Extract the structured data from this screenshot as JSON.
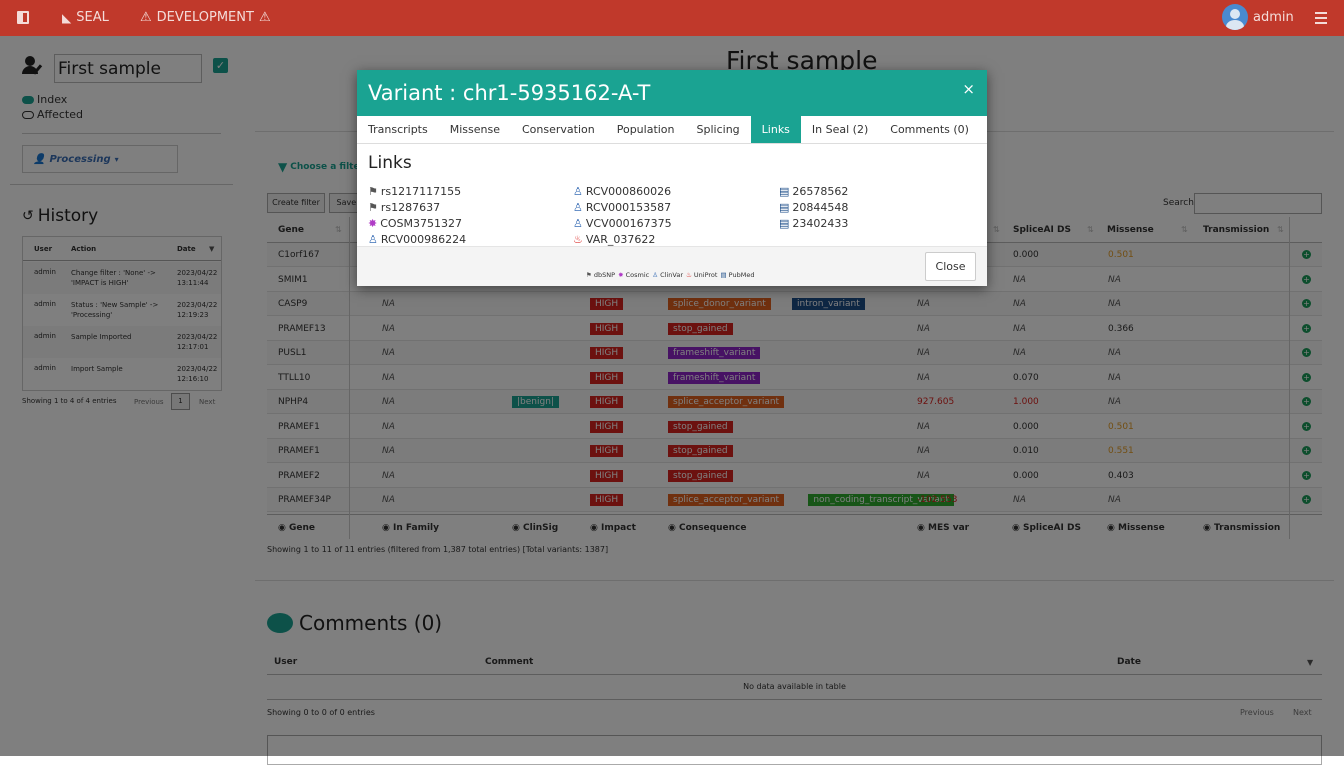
{
  "navbar": {
    "brand": "SEAL",
    "env": "DEVELOPMENT",
    "user": "admin"
  },
  "sidebar": {
    "sample_name": "First sample",
    "index_label": "Index",
    "affected_label": "Affected",
    "status_label": "Processing",
    "history_title": "History",
    "history_headers": [
      "User",
      "Action",
      "Date"
    ],
    "history_rows": [
      {
        "user": "admin",
        "action": "Change filter : 'None' -> 'IMPACT is HIGH'",
        "date": "2023/04/22 13:11:44"
      },
      {
        "user": "admin",
        "action": "Status : 'New Sample' -> 'Processing'",
        "date": "2023/04/22 12:19:23"
      },
      {
        "user": "admin",
        "action": "Sample Imported",
        "date": "2023/04/22 12:17:01"
      },
      {
        "user": "admin",
        "action": "Import Sample",
        "date": "2023/04/22 12:16:10"
      }
    ],
    "history_info": "Showing 1 to 4 of 4 entries",
    "prev": "Previous",
    "page": "1",
    "next": "Next"
  },
  "main": {
    "title": "First sample",
    "choose_filter": "Choose a filter",
    "create_filter": "Create filter",
    "save_filter": "Save f",
    "search_label": "Search:",
    "headers": [
      "Gene",
      "In Family",
      "ClinSig",
      "Impact",
      "Consequence",
      "MES var",
      "SpliceAI DS",
      "Missense",
      "Transmission"
    ],
    "rows": [
      {
        "gene": "C1orf167",
        "family": "",
        "clinsig": "",
        "impact": "",
        "cons": [],
        "mes": "",
        "splice": "0.000",
        "missense": "0.501",
        "missense_color": "#e59d25"
      },
      {
        "gene": "SMIM1",
        "family": "",
        "clinsig": "",
        "impact": "",
        "cons": [],
        "mes": "",
        "splice": "NA",
        "missense": "NA",
        "missense_color": ""
      },
      {
        "gene": "CASP9",
        "family": "NA",
        "clinsig": "",
        "impact": "HIGH",
        "cons": [
          [
            "splice_donor_variant",
            "#e0611f"
          ],
          [
            "intron_variant",
            "#1d4e89"
          ]
        ],
        "mes": "NA",
        "splice": "NA",
        "missense": "NA",
        "missense_color": ""
      },
      {
        "gene": "PRAMEF13",
        "family": "NA",
        "clinsig": "",
        "impact": "HIGH",
        "cons": [
          [
            "stop_gained",
            "#d9231f"
          ]
        ],
        "mes": "NA",
        "splice": "NA",
        "missense": "0.366",
        "missense_color": ""
      },
      {
        "gene": "PUSL1",
        "family": "NA",
        "clinsig": "",
        "impact": "HIGH",
        "cons": [
          [
            "frameshift_variant",
            "#8e24c8"
          ]
        ],
        "mes": "NA",
        "splice": "NA",
        "missense": "NA",
        "missense_color": ""
      },
      {
        "gene": "TTLL10",
        "family": "NA",
        "clinsig": "",
        "impact": "HIGH",
        "cons": [
          [
            "frameshift_variant",
            "#8e24c8"
          ]
        ],
        "mes": "NA",
        "splice": "0.070",
        "missense": "NA",
        "missense_color": ""
      },
      {
        "gene": "NPHP4",
        "family": "NA",
        "clinsig": "|benign|",
        "impact": "HIGH",
        "cons": [
          [
            "splice_acceptor_variant",
            "#e0611f"
          ]
        ],
        "mes": "927.605",
        "splice": "1.000",
        "missense": "NA",
        "missense_color": "",
        "mes_color": "#d9231f",
        "splice_color": "#d9231f"
      },
      {
        "gene": "PRAMEF1",
        "family": "NA",
        "clinsig": "",
        "impact": "HIGH",
        "cons": [
          [
            "stop_gained",
            "#d9231f"
          ]
        ],
        "mes": "NA",
        "splice": "0.000",
        "missense": "0.501",
        "missense_color": "#e59d25"
      },
      {
        "gene": "PRAMEF1",
        "family": "NA",
        "clinsig": "",
        "impact": "HIGH",
        "cons": [
          [
            "stop_gained",
            "#d9231f"
          ]
        ],
        "mes": "NA",
        "splice": "0.010",
        "missense": "0.551",
        "missense_color": "#e59d25"
      },
      {
        "gene": "PRAMEF2",
        "family": "NA",
        "clinsig": "",
        "impact": "HIGH",
        "cons": [
          [
            "stop_gained",
            "#d9231f"
          ]
        ],
        "mes": "NA",
        "splice": "0.000",
        "missense": "0.403",
        "missense_color": ""
      },
      {
        "gene": "PRAMEF34P",
        "family": "NA",
        "clinsig": "",
        "impact": "HIGH",
        "cons": [
          [
            "splice_acceptor_variant",
            "#e0611f"
          ],
          [
            "non_coding_transcript_variant",
            "#2eaa2e"
          ]
        ],
        "mes": "-102.553",
        "splice": "NA",
        "missense": "NA",
        "missense_color": "",
        "mes_color": "#d9231f"
      }
    ],
    "table_info": "Showing 1 to 11 of 11 entries (filtered from 1,387 total entries) [Total variants: 1387]",
    "comments_title": "Comments (0)",
    "comment_headers": [
      "User",
      "Comment",
      "Date"
    ],
    "comments_empty": "No data available in table",
    "comments_info": "Showing 0 to 0 of 0 entries",
    "comments_prev": "Previous",
    "comments_next": "Next"
  },
  "modal": {
    "title": "Variant : chr1-5935162-A-T",
    "close_x": "×",
    "tabs": [
      "Transcripts",
      "Missense",
      "Conservation",
      "Population",
      "Splicing",
      "Links",
      "In Seal (2)",
      "Comments (0)"
    ],
    "active_tab": "Links",
    "links_title": "Links",
    "col1": [
      {
        "text": "rs1217117155",
        "icon": "flag-icon",
        "color": "#555"
      },
      {
        "text": "rs1287637",
        "icon": "flag-icon",
        "color": "#555"
      },
      {
        "text": "COSM3751327",
        "icon": "cosmic-icon",
        "color": "#b03cc6"
      },
      {
        "text": "RCV000986224",
        "icon": "clinvar-icon",
        "color": "#3b6fb6"
      }
    ],
    "col2": [
      {
        "text": "RCV000860026",
        "icon": "clinvar-icon",
        "color": "#3b6fb6"
      },
      {
        "text": "RCV000153587",
        "icon": "clinvar-icon",
        "color": "#3b6fb6"
      },
      {
        "text": "VCV000167375",
        "icon": "clinvar-icon",
        "color": "#3b6fb6"
      },
      {
        "text": "VAR_037622",
        "icon": "uniprot-icon",
        "color": "#d9231f"
      }
    ],
    "col3": [
      {
        "text": "26578562",
        "icon": "book-icon",
        "color": "#1d4e89"
      },
      {
        "text": "20844548",
        "icon": "book-icon",
        "color": "#1d4e89"
      },
      {
        "text": "23402433",
        "icon": "book-icon",
        "color": "#1d4e89"
      }
    ],
    "legend": [
      "dbSNP",
      "Cosmic",
      "ClinVar",
      "UniProt",
      "PubMed"
    ],
    "close_button": "Close"
  }
}
